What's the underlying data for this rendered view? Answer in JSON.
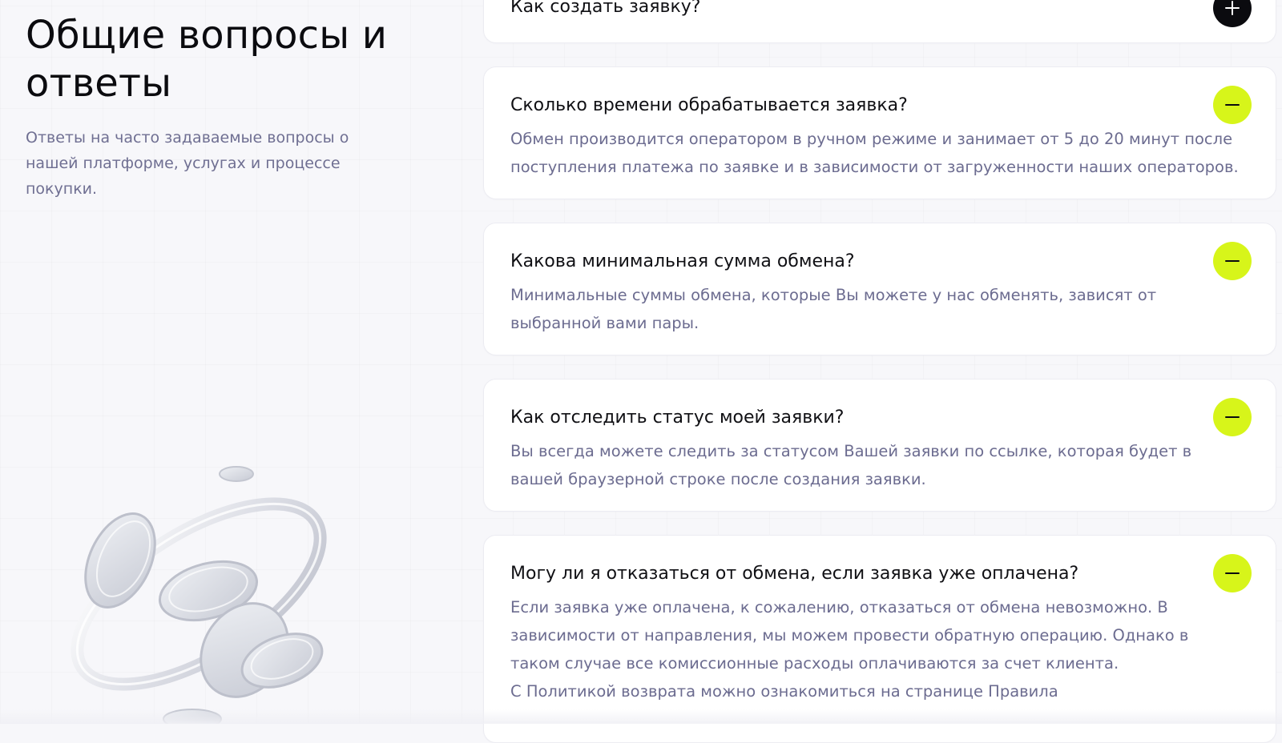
{
  "intro": {
    "title_line1": "Общие вопросы и",
    "title_line2": "ответы",
    "subtitle": "Ответы на часто задаваемые вопросы о нашей платформе, услугах и процессе покупки."
  },
  "faq": {
    "items": [
      {
        "question": "Как создать заявку?",
        "answer": "",
        "expanded": false,
        "toggle_icon": "plus-icon"
      },
      {
        "question": "Сколько времени обрабатывается заявка?",
        "answer": "Обмен производится оператором в ручном режиме и занимает от 5 до 20 минут после\nпоступления платежа по заявке и в зависимости от загруженности наших операторов.",
        "expanded": true,
        "toggle_icon": "minus-icon"
      },
      {
        "question": "Какова минимальная сумма обмена?",
        "answer": "Минимальные суммы обмена, которые Вы можете у нас обменять, зависят от\nвыбранной вами пары.",
        "expanded": true,
        "toggle_icon": "minus-icon"
      },
      {
        "question": "Как отследить статус моей заявки?",
        "answer": "Вы всегда можете следить за статусом Вашей заявки по ссылке, которая будет в\nвашей браузерной строке после создания заявки.",
        "expanded": true,
        "toggle_icon": "minus-icon"
      },
      {
        "question": "Могу ли я отказаться от обмена, если заявка уже оплачена?",
        "answer": "Если заявка уже оплачена, к сожалению, отказаться от обмена невозможно. В\nзависимости от направления, мы можем провести обратную операцию. Однако в\nтаком случае все комиссионные расходы оплачиваются за счет клиента.\nС Политикой возврата можно ознакомиться на странице Правила",
        "expanded": true,
        "toggle_icon": "minus-icon"
      }
    ]
  },
  "colors": {
    "accent": "#d7f51a",
    "text_primary": "#0b0b0f",
    "text_secondary": "#6c6c90",
    "card_bg": "#ffffff",
    "page_bg": "#f7f7fa"
  }
}
